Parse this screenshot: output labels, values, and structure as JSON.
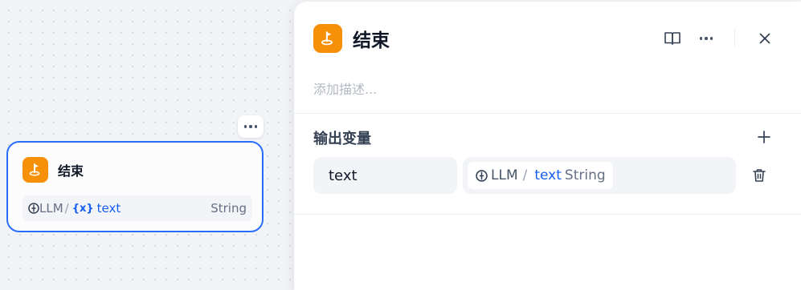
{
  "node": {
    "title": "结束",
    "variable": {
      "source": "LLM",
      "separator": "/",
      "var_symbol": "{x}",
      "name": "text",
      "type": "String"
    }
  },
  "panel": {
    "title": "结束",
    "description_placeholder": "添加描述...",
    "output_section_title": "输出变量",
    "outputs": [
      {
        "name": "text",
        "source": "LLM",
        "separator": "/",
        "value": "text",
        "type": "String"
      }
    ]
  },
  "colors": {
    "accent": "#296dff",
    "icon_bg": "#f79009",
    "variable_blue": "#155eef"
  },
  "icons": [
    "end-node-icon",
    "llm-icon",
    "variable-icon",
    "book-icon",
    "more-icon",
    "close-icon",
    "plus-icon",
    "trash-icon"
  ]
}
